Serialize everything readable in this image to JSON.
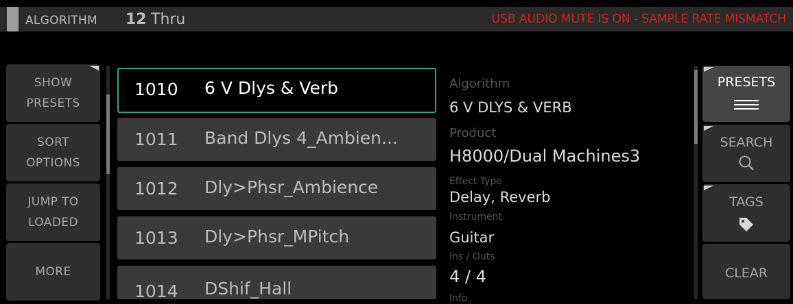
{
  "header": {
    "label": "ALGORITHM",
    "algorithm_number": "12",
    "algorithm_name": "Thru",
    "warning": "USB AUDIO MUTE IS ON - SAMPLE RATE MISMATCH",
    "warning_color": "#cc1f1f"
  },
  "left_menu": [
    {
      "line1": "SHOW",
      "line2": "PRESETS"
    },
    {
      "line1": "SORT",
      "line2": "OPTIONS"
    },
    {
      "line1": "JUMP TO",
      "line2": "LOADED"
    },
    {
      "line1": "MORE",
      "line2": ""
    }
  ],
  "presets": [
    {
      "number": "1010",
      "name": "6 V Dlys & Verb",
      "selected": true
    },
    {
      "number": "1011",
      "name": "Band Dlys 4_Ambien..."
    },
    {
      "number": "1012",
      "name": "Dly>Phsr_Ambience"
    },
    {
      "number": "1013",
      "name": "Dly>Phsr_MPitch"
    },
    {
      "number": "1014",
      "name": "DShif_Hall"
    }
  ],
  "selection_color": "#2aa889",
  "info": {
    "algorithm_label": "Algorithm",
    "algorithm_value": "6 V DLYS & VERB",
    "product_label": "Product",
    "product_value": "H8000/Dual Machines3",
    "effect_type_label": "Effect Type",
    "effect_type_value": "Delay, Reverb",
    "instrument_label": "Instrument",
    "instrument_value": "Guitar",
    "io_label": "Ins / Outs",
    "io_value": "4 / 4",
    "partial_label": "Info"
  },
  "right_menu": {
    "presets_label": "PRESETS",
    "presets_icon": "list-icon",
    "search_label": "SEARCH",
    "search_icon": "search-icon",
    "tags_label": "TAGS",
    "tags_icon": "tag-icon",
    "clear_label": "CLEAR"
  }
}
